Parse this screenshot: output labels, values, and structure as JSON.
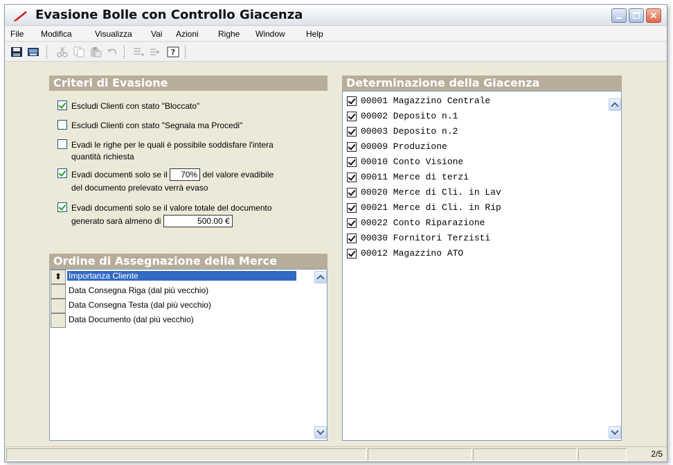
{
  "window": {
    "title": "Evasione Bolle con Controllo Giacenza"
  },
  "menu": [
    "File",
    "Modifica",
    "Visualizza",
    "Vai",
    "Azioni",
    "Righe",
    "Window",
    "Help"
  ],
  "criteri": {
    "title": "Criteri di Evasione",
    "items": [
      {
        "checked": true,
        "label": "Escludi Clienti con stato \"Bloccato\""
      },
      {
        "checked": false,
        "label": "Escludi Clienti con stato \"Segnala ma Procedi\""
      },
      {
        "checked": false,
        "label_line1": "Evadi le righe per le quali è possibile soddisfare l'intera",
        "label_line2": "quantità richiesta"
      },
      {
        "checked": true,
        "label_pre": "Evadi documenti solo se il",
        "value": "70%",
        "label_post": "del valore evadibile",
        "label_line2": "del documento prelevato verrà evaso"
      },
      {
        "checked": true,
        "label_line1": "Evadi documenti solo se il valore totale del documento",
        "label_pre2": "generato sarà almeno di",
        "value": "500.00 €"
      }
    ]
  },
  "ordine": {
    "title": "Ordine di Assegnazione della Merce",
    "items": [
      {
        "label": "Importanza Cliente",
        "selected": true
      },
      {
        "label": "Data Consegna Riga (dal più vecchio)",
        "selected": false
      },
      {
        "label": "Data Consegna Testa (dal più vecchio)",
        "selected": false
      },
      {
        "label": "Data Documento (dal più vecchio)",
        "selected": false
      }
    ]
  },
  "giacenza": {
    "title": "Determinazione della Giacenza",
    "items": [
      {
        "checked": true,
        "label": "00001 Magazzino Centrale"
      },
      {
        "checked": true,
        "label": "00002 Deposito n.1"
      },
      {
        "checked": true,
        "label": "00003 Deposito n.2"
      },
      {
        "checked": true,
        "label": "00009 Produzione"
      },
      {
        "checked": true,
        "label": "00010 Conto Visione"
      },
      {
        "checked": true,
        "label": "00011 Merce di terzi"
      },
      {
        "checked": true,
        "label": "00020 Merce di Cli. in Lav"
      },
      {
        "checked": true,
        "label": "00021 Merce di Cli. in Rip"
      },
      {
        "checked": true,
        "label": "00022 Conto Riparazione"
      },
      {
        "checked": true,
        "label": "00030 Fornitori Terzisti"
      },
      {
        "checked": true,
        "label": "00012 Magazzino ATO"
      }
    ]
  },
  "status": {
    "page": "2/5"
  },
  "colors": {
    "panel_header": "#b8ad9b",
    "selection": "#316ac5",
    "check_green": "#21a121"
  }
}
